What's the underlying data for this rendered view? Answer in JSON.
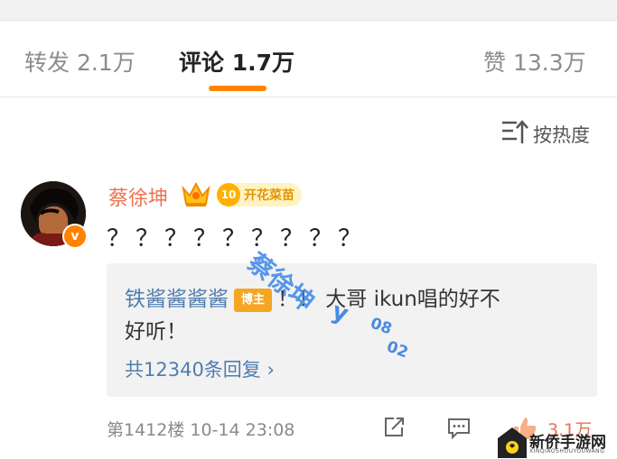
{
  "tabs": {
    "repost": "转发 2.1万",
    "comment": "评论 1.7万",
    "like": "赞 13.3万"
  },
  "sort": {
    "label": "按热度",
    "icon": "sort-icon"
  },
  "comment": {
    "username": "蔡徐坤",
    "verified_badge": "v",
    "level_number": "10",
    "level_label": "开花菜苗",
    "text": "？？？？？？？？？",
    "reply": {
      "user": "铁酱酱酱酱",
      "badge": "博主",
      "text_after": "！！ 大哥 ikun唱的好不",
      "text_line2": "好听！",
      "more": "共12340条回复 ›"
    },
    "meta": "第1412楼 10-14 23:08",
    "like_count": "3.1万"
  },
  "watermark": {
    "name": "蔡徐坤",
    "letter": "y",
    "num1": "08",
    "num2": "02"
  },
  "site_logo": {
    "name": "新侨手游网",
    "sub": "XINQIAOSHOUYOUWANG"
  },
  "colors": {
    "accent": "#ff8200",
    "username": "#eb7350",
    "link": "#507daf"
  }
}
